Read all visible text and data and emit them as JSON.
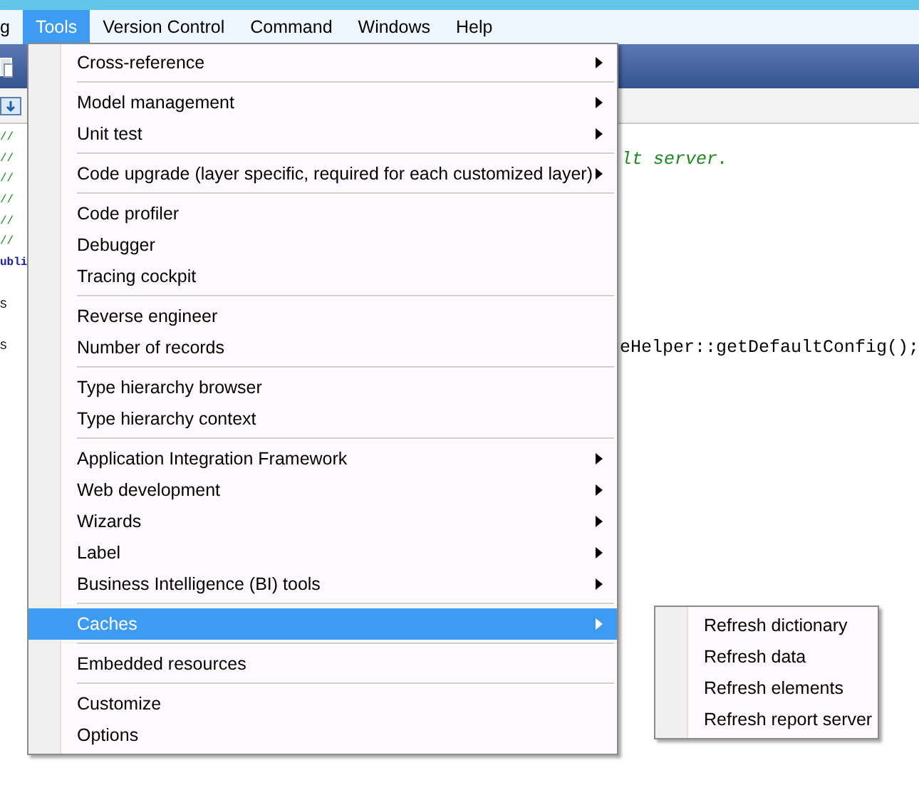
{
  "menubar": {
    "items": [
      {
        "label": "g",
        "selected": false
      },
      {
        "label": "Tools",
        "selected": true
      },
      {
        "label": "Version Control",
        "selected": false
      },
      {
        "label": "Command",
        "selected": false
      },
      {
        "label": "Windows",
        "selected": false
      },
      {
        "label": "Help",
        "selected": false
      }
    ]
  },
  "editor": {
    "lines": [
      {
        "kind": "text",
        "left": {
          "kind": "comment",
          "text": "//"
        }
      },
      {
        "kind": "text",
        "left": {
          "kind": "comment",
          "text": "//"
        },
        "right": {
          "kind": "comment",
          "text": "lt server."
        }
      },
      {
        "kind": "text",
        "left": {
          "kind": "comment",
          "text": "//"
        }
      },
      {
        "kind": "text",
        "left": {
          "kind": "comment",
          "text": "//"
        }
      },
      {
        "kind": "text",
        "left": {
          "kind": "comment",
          "text": "//"
        }
      },
      {
        "kind": "text",
        "left": {
          "kind": "comment",
          "text": "//"
        }
      },
      {
        "kind": "text",
        "left": {
          "kind": "keyword",
          "text": "ubli"
        }
      },
      {
        "kind": "blank"
      },
      {
        "kind": "text",
        "left": {
          "kind": "code",
          "text": "S"
        }
      },
      {
        "kind": "blank"
      },
      {
        "kind": "text",
        "left": {
          "kind": "code",
          "text": "S"
        },
        "right": {
          "kind": "code",
          "text": "eHelper::getDefaultConfig();"
        }
      }
    ]
  },
  "menu": {
    "items": [
      {
        "kind": "item",
        "label": "Cross-reference",
        "submenu": true,
        "selected": false
      },
      {
        "kind": "separator"
      },
      {
        "kind": "item",
        "label": "Model management",
        "submenu": true,
        "selected": false
      },
      {
        "kind": "item",
        "label": "Unit test",
        "submenu": true,
        "selected": false
      },
      {
        "kind": "separator"
      },
      {
        "kind": "item",
        "label": "Code upgrade (layer specific, required for each customized layer)",
        "submenu": true,
        "selected": false
      },
      {
        "kind": "separator"
      },
      {
        "kind": "item",
        "label": "Code profiler",
        "submenu": false,
        "selected": false
      },
      {
        "kind": "item",
        "label": "Debugger",
        "submenu": false,
        "selected": false
      },
      {
        "kind": "item",
        "label": "Tracing cockpit",
        "submenu": false,
        "selected": false
      },
      {
        "kind": "separator"
      },
      {
        "kind": "item",
        "label": "Reverse engineer",
        "submenu": false,
        "selected": false
      },
      {
        "kind": "item",
        "label": "Number of records",
        "submenu": false,
        "selected": false
      },
      {
        "kind": "separator"
      },
      {
        "kind": "item",
        "label": "Type hierarchy browser",
        "submenu": false,
        "selected": false
      },
      {
        "kind": "item",
        "label": "Type hierarchy context",
        "submenu": false,
        "selected": false
      },
      {
        "kind": "separator"
      },
      {
        "kind": "item",
        "label": "Application Integration Framework",
        "submenu": true,
        "selected": false
      },
      {
        "kind": "item",
        "label": "Web development",
        "submenu": true,
        "selected": false
      },
      {
        "kind": "item",
        "label": "Wizards",
        "submenu": true,
        "selected": false
      },
      {
        "kind": "item",
        "label": "Label",
        "submenu": true,
        "selected": false
      },
      {
        "kind": "item",
        "label": "Business Intelligence (BI) tools",
        "submenu": true,
        "selected": false
      },
      {
        "kind": "separator"
      },
      {
        "kind": "item",
        "label": "Caches",
        "submenu": true,
        "selected": true
      },
      {
        "kind": "separator"
      },
      {
        "kind": "item",
        "label": "Embedded resources",
        "submenu": false,
        "selected": false
      },
      {
        "kind": "separator"
      },
      {
        "kind": "item",
        "label": "Customize",
        "submenu": false,
        "selected": false
      },
      {
        "kind": "item",
        "label": "Options",
        "submenu": false,
        "selected": false
      }
    ]
  },
  "submenu": {
    "items": [
      {
        "label": "Refresh dictionary",
        "selected": false
      },
      {
        "label": "Refresh data",
        "selected": false
      },
      {
        "label": "Refresh elements",
        "selected": false
      },
      {
        "label": "Refresh report server",
        "selected": false
      }
    ]
  }
}
